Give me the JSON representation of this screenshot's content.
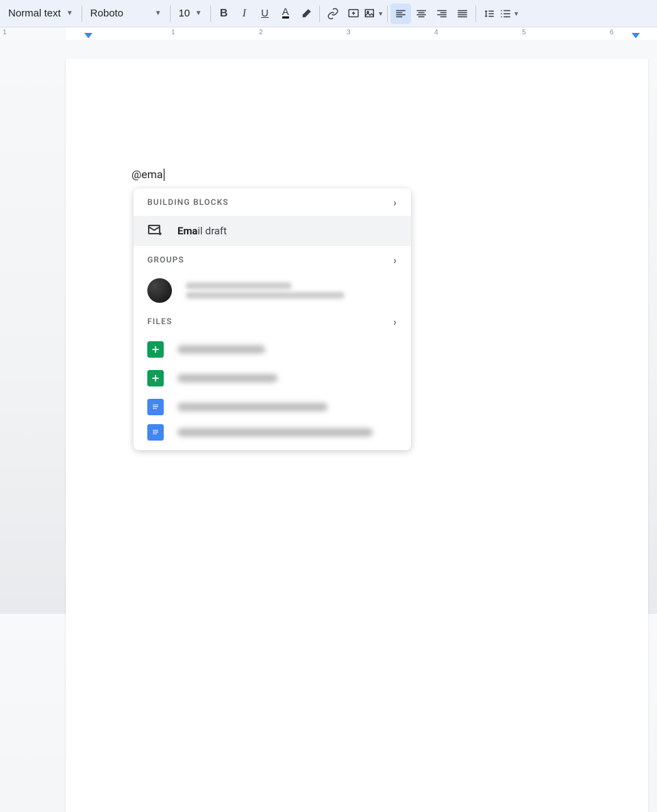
{
  "toolbar": {
    "style_dropdown": "Normal text",
    "font_dropdown": "Roboto",
    "size_dropdown": "10"
  },
  "document": {
    "typed_text": "@ema"
  },
  "suggest": {
    "sections": {
      "building_blocks": "BUILDING BLOCKS",
      "groups": "GROUPS",
      "files": "FILES"
    },
    "email_draft": {
      "bold_part": "Ema",
      "rest": "il draft"
    }
  },
  "ruler": {
    "ticks": [
      "1",
      "1",
      "2",
      "3",
      "4",
      "5",
      "6"
    ]
  }
}
